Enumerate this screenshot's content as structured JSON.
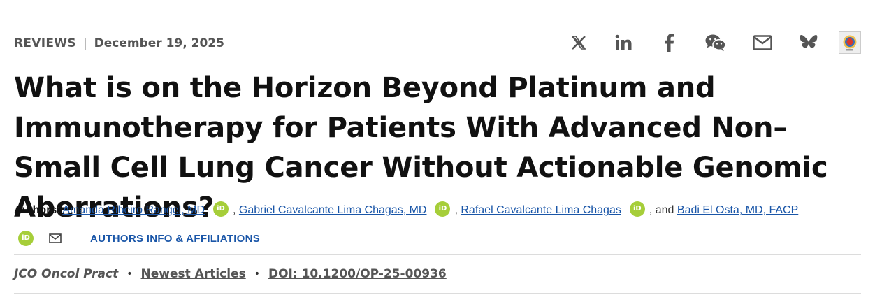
{
  "header": {
    "article_type": "REVIEWS",
    "separator": "|",
    "date": "December 19, 2025"
  },
  "share": {
    "icons": [
      "x-icon",
      "linkedin-icon",
      "facebook-icon",
      "wechat-icon",
      "email-icon",
      "bluesky-icon",
      "mendeley-icon"
    ],
    "icon_color": "#555555"
  },
  "title": "What is on the Horizon Beyond Platinum and Immunotherapy for Patients With Advanced Non–Small Cell Lung Cancer Without Actionable Genomic Aberrations?",
  "authors": {
    "label": "Authors",
    "colon": ": ",
    "list": [
      {
        "name": "Amanda Ribeiro Rangel, MD"
      },
      {
        "name": "Gabriel Cavalcante Lima Chagas, MD"
      },
      {
        "name": "Rafael Cavalcante Lima Chagas"
      },
      {
        "name": "Badi El Osta, MD, FACP"
      }
    ],
    "comma": ",",
    "and_text": ", and",
    "orcid_text": "iD",
    "orcid_color": "#a6ce39",
    "affiliations_link": "AUTHORS INFO & AFFILIATIONS"
  },
  "citation": {
    "journal": "JCO Oncol Pract",
    "bullet": "•",
    "section": "Newest Articles",
    "doi": "DOI: 10.1200/OP-25-00936"
  },
  "colors": {
    "link": "#1a56a8",
    "text": "#111111",
    "muted": "#555555"
  }
}
